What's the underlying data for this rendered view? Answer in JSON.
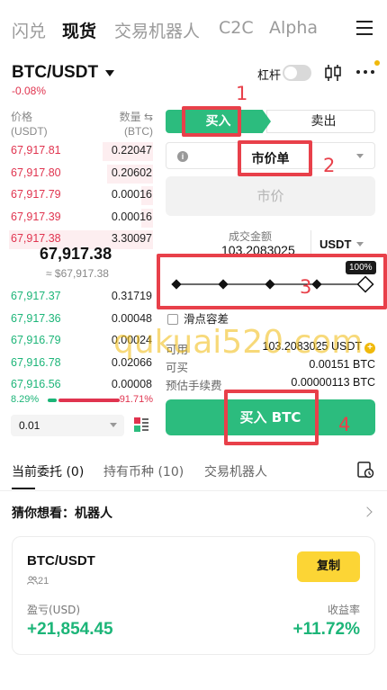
{
  "top_tabs": [
    "闪兑",
    "现货",
    "交易机器人",
    "C2C",
    "Alpha"
  ],
  "pair": {
    "name": "BTC/USDT",
    "change": "-0.08%",
    "leverage_label": "杠杆"
  },
  "orderbook": {
    "price_header": "价格\n(USDT)",
    "qty_header_line1": "数量 ⇆",
    "qty_header_line2": "(BTC)",
    "asks": [
      {
        "price": "67,917.81",
        "qty": "0.22047",
        "depth": 0.35
      },
      {
        "price": "67,917.80",
        "qty": "0.20602",
        "depth": 0.32
      },
      {
        "price": "67,917.79",
        "qty": "0.00016",
        "depth": 0.08
      },
      {
        "price": "67,917.39",
        "qty": "0.00016",
        "depth": 0.08
      },
      {
        "price": "67,917.38",
        "qty": "3.30097",
        "depth": 1.0
      }
    ],
    "mid_price": "67,917.38",
    "mid_price_usd": "≈ $67,917.38",
    "bids": [
      {
        "price": "67,917.37",
        "qty": "0.31719"
      },
      {
        "price": "67,917.36",
        "qty": "0.00048"
      },
      {
        "price": "67,916.79",
        "qty": "0.00024"
      },
      {
        "price": "67,916.78",
        "qty": "0.02066"
      },
      {
        "price": "67,916.56",
        "qty": "0.00008"
      }
    ],
    "buy_ratio": "8.29%",
    "sell_ratio": "91.71%",
    "depth_value": "0.01"
  },
  "form": {
    "buy_label": "买入",
    "sell_label": "卖出",
    "order_type": "市价单",
    "price_placeholder": "市价",
    "amount_label": "成交金额",
    "amount_value": "103.2083025",
    "amount_unit": "USDT",
    "slider_pct": "100%",
    "slippage_label": "滑点容差",
    "available_label": "可用",
    "available_value": "103.2083025 USDT",
    "can_buy_label": "可买",
    "can_buy_value": "0.00151 BTC",
    "fee_label": "预估手续费",
    "fee_value": "0.00000113 BTC",
    "submit_label": "买入 BTC"
  },
  "annotations": [
    "1",
    "2",
    "3",
    "4"
  ],
  "watermark": "qukuai520.com",
  "bottom_tabs": {
    "open_orders": "当前委托 (0)",
    "holdings": "持有币种 (10)",
    "bots": "交易机器人"
  },
  "guess": {
    "title": "猜你想看：机器人"
  },
  "bot_card": {
    "pair": "BTC/USDT",
    "users": "21",
    "copy_label": "复制",
    "pnl_label": "盈亏(USD)",
    "pnl_value": "+21,854.45",
    "roi_label": "收益率",
    "roi_value": "+11.72%"
  },
  "colors": {
    "green": "#2cbc7e",
    "red": "#e0344f",
    "highlight": "#e8404a",
    "yellow": "#fcd535"
  },
  "icons": [
    "menu-icon",
    "candlestick-icon",
    "more-icon",
    "layout-icon",
    "history-icon",
    "chevron-right-icon",
    "users-icon",
    "plus-icon",
    "info-icon"
  ]
}
